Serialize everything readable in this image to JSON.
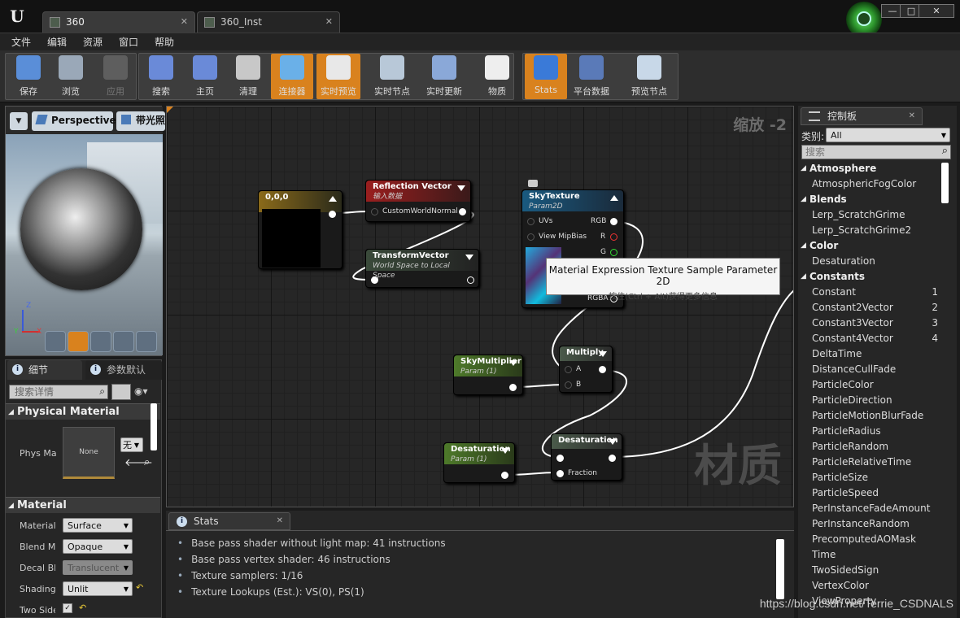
{
  "doc_tabs": [
    {
      "label": "360"
    },
    {
      "label": "360_Inst"
    }
  ],
  "menu": [
    "文件",
    "编辑",
    "资源",
    "窗口",
    "帮助"
  ],
  "toolbar": [
    {
      "label": "保存",
      "icon": "save-icon",
      "state": "normal"
    },
    {
      "label": "浏览",
      "icon": "browse-icon",
      "state": "normal"
    },
    {
      "label": "应用",
      "icon": "apply-icon",
      "state": "disabled"
    },
    {
      "label": "搜索",
      "icon": "search-icon",
      "state": "normal"
    },
    {
      "label": "主页",
      "icon": "home-icon",
      "state": "normal"
    },
    {
      "label": "清理",
      "icon": "clean-icon",
      "state": "normal"
    },
    {
      "label": "连接器",
      "icon": "connectors-icon",
      "state": "active"
    },
    {
      "label": "实时预览",
      "icon": "live-preview-icon",
      "state": "active"
    },
    {
      "label": "实时节点",
      "icon": "live-nodes-icon",
      "state": "normal"
    },
    {
      "label": "实时更新",
      "icon": "live-update-icon",
      "state": "normal"
    },
    {
      "label": "物质",
      "icon": "substance-icon",
      "state": "normal"
    },
    {
      "label": "Stats",
      "icon": "stats-icon",
      "state": "active"
    },
    {
      "label": "平台数据",
      "icon": "platform-stats-icon",
      "state": "normal"
    },
    {
      "label": "预览节点",
      "icon": "preview-node-icon",
      "state": "normal"
    }
  ],
  "viewport": {
    "perspective": "Perspective",
    "lit": "带光照",
    "axes": {
      "z": "Z",
      "y": "Y",
      "x": "X"
    }
  },
  "details": {
    "tab_details": "细节",
    "tab_params": "参数默认",
    "search_placeholder": "搜索详情",
    "physical_material_header": "Physical Material",
    "phys_label": "Phys Ma",
    "phys_thumb": "None",
    "phys_value": "无",
    "material_header": "Material",
    "props": [
      {
        "label": "Material",
        "value": "Surface",
        "disabled": false
      },
      {
        "label": "Blend Mo",
        "value": "Opaque",
        "disabled": false
      },
      {
        "label": "Decal Ble",
        "value": "Translucent",
        "disabled": true
      },
      {
        "label": "Shading",
        "value": "Unlit",
        "disabled": false
      },
      {
        "label": "Two Side",
        "value": "",
        "disabled": false
      }
    ]
  },
  "graph": {
    "zoom": "缩放 -2",
    "watermark": "材质",
    "nodes": {
      "const": {
        "title": "0,0,0"
      },
      "reflection": {
        "title": "Reflection Vector",
        "subtitle": "输入数据",
        "pin": "CustomWorldNormal"
      },
      "transform": {
        "title": "TransformVector",
        "subtitle": "World Space to Local Space"
      },
      "sky": {
        "title": "SkyTexture",
        "subtitle": "Param2D",
        "pins_in": [
          "UVs",
          "View MipBias"
        ],
        "pins_out": [
          "RGB",
          "R",
          "G",
          "RGBA"
        ]
      },
      "skymult": {
        "title": "SkyMultiplier",
        "subtitle": "Param (1)"
      },
      "multiply": {
        "title": "Multiply",
        "pins": [
          "A",
          "B"
        ]
      },
      "desatparam": {
        "title": "Desaturation",
        "subtitle": "Param (1)"
      },
      "desat": {
        "title": "Desaturation",
        "pins": [
          "",
          "Fraction"
        ]
      }
    },
    "tooltip": {
      "title": "Material Expression Texture Sample Parameter 2D",
      "hint": "按住(Ctrl + Alt)获得更多信息"
    }
  },
  "stats": {
    "tab": "Stats",
    "lines": [
      "Base pass shader without light map: 41 instructions",
      "Base pass vertex shader: 46 instructions",
      "Texture samplers: 1/16",
      "Texture Lookups (Est.): VS(0), PS(1)"
    ]
  },
  "palette": {
    "tab": "控制板",
    "category_label": "类别:",
    "category_value": "All",
    "search_placeholder": "搜索",
    "items": [
      {
        "label": "Atmosphere",
        "cat": true,
        "count": ""
      },
      {
        "label": "AtmosphericFogColor",
        "cat": false,
        "count": ""
      },
      {
        "label": "Blends",
        "cat": true,
        "count": ""
      },
      {
        "label": "Lerp_ScratchGrime",
        "cat": false,
        "count": ""
      },
      {
        "label": "Lerp_ScratchGrime2",
        "cat": false,
        "count": ""
      },
      {
        "label": "Color",
        "cat": true,
        "count": ""
      },
      {
        "label": "Desaturation",
        "cat": false,
        "count": ""
      },
      {
        "label": "Constants",
        "cat": true,
        "count": ""
      },
      {
        "label": "Constant",
        "cat": false,
        "count": "1"
      },
      {
        "label": "Constant2Vector",
        "cat": false,
        "count": "2"
      },
      {
        "label": "Constant3Vector",
        "cat": false,
        "count": "3"
      },
      {
        "label": "Constant4Vector",
        "cat": false,
        "count": "4"
      },
      {
        "label": "DeltaTime",
        "cat": false,
        "count": ""
      },
      {
        "label": "DistanceCullFade",
        "cat": false,
        "count": ""
      },
      {
        "label": "ParticleColor",
        "cat": false,
        "count": ""
      },
      {
        "label": "ParticleDirection",
        "cat": false,
        "count": ""
      },
      {
        "label": "ParticleMotionBlurFade",
        "cat": false,
        "count": ""
      },
      {
        "label": "ParticleRadius",
        "cat": false,
        "count": ""
      },
      {
        "label": "ParticleRandom",
        "cat": false,
        "count": ""
      },
      {
        "label": "ParticleRelativeTime",
        "cat": false,
        "count": ""
      },
      {
        "label": "ParticleSize",
        "cat": false,
        "count": ""
      },
      {
        "label": "ParticleSpeed",
        "cat": false,
        "count": ""
      },
      {
        "label": "PerInstanceFadeAmount",
        "cat": false,
        "count": ""
      },
      {
        "label": "PerInstanceRandom",
        "cat": false,
        "count": ""
      },
      {
        "label": "PrecomputedAOMask",
        "cat": false,
        "count": ""
      },
      {
        "label": "Time",
        "cat": false,
        "count": ""
      },
      {
        "label": "TwoSidedSign",
        "cat": false,
        "count": ""
      },
      {
        "label": "VertexColor",
        "cat": false,
        "count": ""
      },
      {
        "label": "ViewProperty",
        "cat": false,
        "count": ""
      }
    ]
  },
  "watermark_url": "https://blog.csdn.net/Terrie_CSDNALS",
  "colors": {
    "accent": "#d9821e",
    "reflection_header": "#8a1a1a",
    "param_header": "#4a6a2a",
    "texture_header": "#1a4a6a",
    "math_header": "#3a4a3a"
  }
}
